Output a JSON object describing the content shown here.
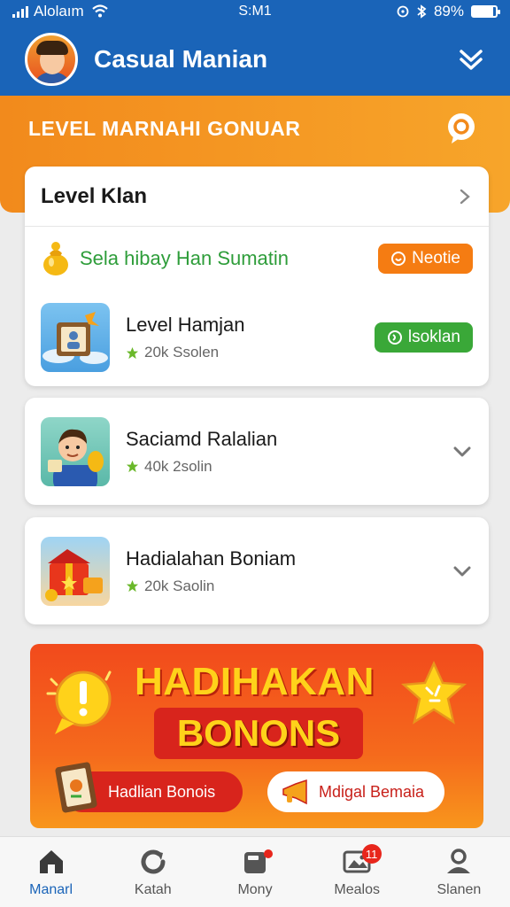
{
  "status_bar": {
    "carrier": "Alolaım",
    "time": "S:M1",
    "battery": "89%",
    "battery_level": 0.89
  },
  "header": {
    "title": "Casual Manian",
    "avatar_icon": "avatar",
    "action_icon": "check-down-icon"
  },
  "banner": {
    "title": "LEVEL MARNAHI GONUAR",
    "icon": "chat-bubble-icon"
  },
  "card_main": {
    "title": "Level Klan",
    "promo": {
      "text": "Sela hibay Han Sumatin",
      "button": "Neotie"
    },
    "item": {
      "title": "Level Hamjan",
      "meta": "20k Ssolen",
      "button": "lsoklan"
    }
  },
  "cards": [
    {
      "title": "Saciamd Ralalian",
      "meta": "40k 2solin"
    },
    {
      "title": "Hadialahan Boniam",
      "meta": "20k Saolin"
    }
  ],
  "bonus": {
    "title_line1": "HADIHAKAN",
    "title_line2": "BONONS",
    "button1": "Hadlian Bonois",
    "button2": "Mdigal Bemaia"
  },
  "tabs": [
    {
      "label": "Manarl",
      "icon": "home-icon",
      "active": true
    },
    {
      "label": "Katah",
      "icon": "refresh-icon",
      "active": false
    },
    {
      "label": "Mony",
      "icon": "wallet-icon",
      "active": false
    },
    {
      "label": "Mealos",
      "icon": "photo-icon",
      "active": false,
      "badge": "11"
    },
    {
      "label": "Slanen",
      "icon": "profile-icon",
      "active": false
    }
  ],
  "colors": {
    "primary_blue": "#1a64b8",
    "banner_orange": "#f28a1c",
    "promo_green": "#2e9d3a",
    "pill_orange": "#f57c12",
    "pill_green": "#3aa838",
    "bonus_red": "#f24a1c",
    "bonus_yellow": "#ffd21a"
  }
}
